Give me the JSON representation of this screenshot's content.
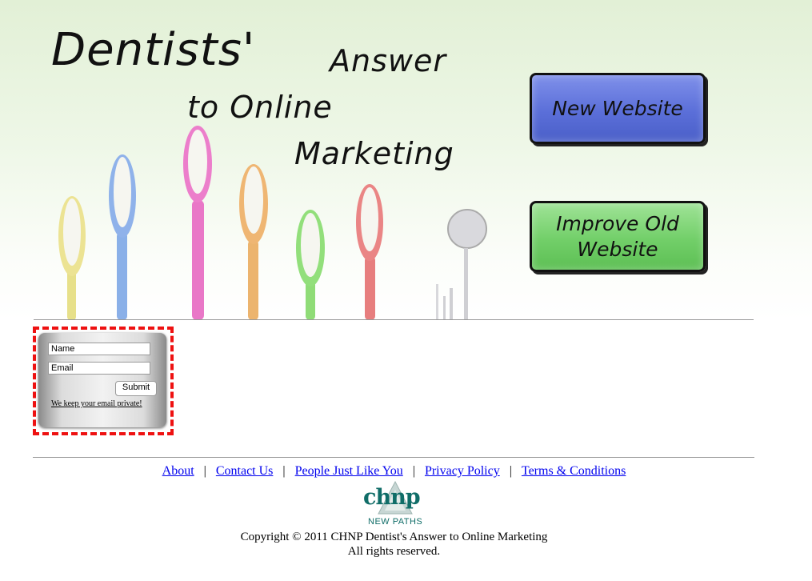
{
  "hero": {
    "headline_line1": "Dentists'",
    "headline_line2": "Answer",
    "headline_line3": "to Online",
    "headline_line4": "Marketing",
    "new_website_label": "New Website",
    "improve_line1": "Improve Old",
    "improve_line2": "Website"
  },
  "signup": {
    "name_value": "Name",
    "email_value": "Email",
    "submit_label": "Submit",
    "privacy_text": "We keep your email private!"
  },
  "footer": {
    "links": [
      "About",
      "Contact Us",
      "People Just Like You",
      "Privacy Policy",
      "Terms & Conditions"
    ],
    "separator": "|",
    "logo_text": "chnp",
    "logo_subtext": "NEW PATHS",
    "copyright": "Copyright © 2011 CHNP Dentist's Answer to Online Marketing",
    "rights": "All rights reserved."
  },
  "colors": {
    "new_button": "#5b6fd9",
    "improve_button": "#72cf69",
    "form_border": "#ee1111",
    "link": "#0000ee",
    "logo": "#106d68"
  }
}
